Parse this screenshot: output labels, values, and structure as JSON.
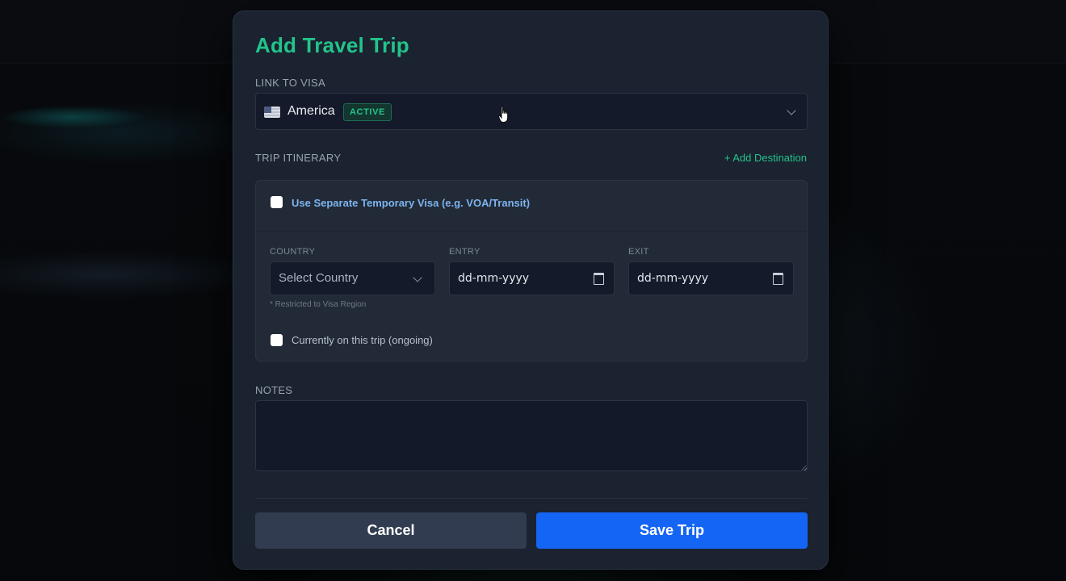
{
  "modal": {
    "title": "Add Travel Trip",
    "link_to_visa_label": "LINK TO VISA",
    "visa": {
      "selected": "America",
      "status": "ACTIVE",
      "flag_icon": "us-flag-icon"
    },
    "trip_itinerary_label": "TRIP ITINERARY",
    "add_destination_label": "+ Add Destination",
    "temporary_visa_label": "Use Separate Temporary Visa (e.g. VOA/Transit)",
    "temporary_visa_checked": false,
    "columns": {
      "country": "COUNTRY",
      "entry": "ENTRY",
      "exit": "EXIT"
    },
    "country_placeholder": "Select Country",
    "entry_value": "dd-mm-yyyy",
    "exit_value": "dd-mm-yyyy",
    "restriction_hint": "* Restricted to Visa Region",
    "ongoing_label": "Currently on this trip (ongoing)",
    "ongoing_checked": false,
    "notes_label": "NOTES",
    "notes_value": "",
    "cancel_label": "Cancel",
    "save_label": "Save Trip"
  },
  "colors": {
    "accent_green": "#22c48a",
    "primary_blue": "#1565f5",
    "link_blue": "#7db4ee"
  }
}
